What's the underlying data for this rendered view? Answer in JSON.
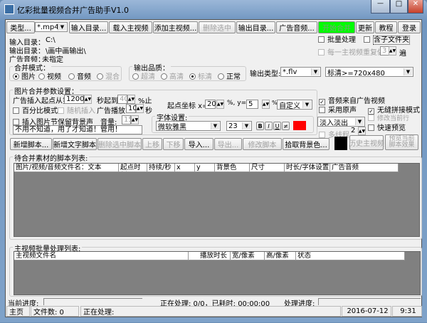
{
  "window": {
    "title": "亿彩批量视频合并广告助手V1.0"
  },
  "toolbar": {
    "type": "类型...",
    "type_value": "*.mp4",
    "input_dir": "输入目录...",
    "load_main": "载入主视频",
    "add_main": "添加主视频...",
    "delete_sel": "删除选中",
    "output_dir": "输出目录...",
    "ad_audio": "广告音频...",
    "start": "开始合并",
    "update": "更新",
    "tutorial": "教程",
    "login": "登录",
    "start_color": "#00ff00"
  },
  "info": {
    "input_label": "输入目录：",
    "input_value": "C:\\",
    "output_label": "输出目录：",
    "output_value": "\\画中画输出\\",
    "audio_label": "广告音频：",
    "audio_value": "未指定"
  },
  "batch": {
    "batch_process": "批量处理",
    "subfolders": "含子文件夹",
    "repeat": "每一主视频重复做",
    "repeat_value": "3",
    "times": "遍"
  },
  "merge_mode": {
    "label": "合并模式：",
    "options": [
      "图片",
      "视频",
      "音频",
      "混合"
    ],
    "selected": "图片"
  },
  "quality": {
    "label": "输出品质：",
    "options": [
      "超清",
      "高清",
      "标清",
      "正常"
    ],
    "selected": "标清"
  },
  "output_type": {
    "label": "输出类型:",
    "value": "*.flv",
    "resolution": "标清>=720x480"
  },
  "image_params": {
    "label": "图片合并参数设置：",
    "start_from": "广告插入起点从第",
    "start_value": "1200",
    "sec_to": "秒起到",
    "to_value": "40",
    "pct_end": "%止",
    "percent_mode": "百分比模式",
    "random_insert": "随机插入",
    "ad_play": "广告播放:",
    "play_value": "10",
    "sec": "秒",
    "keep_bg": "插入图片节保留背景声",
    "volume": "音量:",
    "volume_value": "15",
    "text": "不用不知道，用了才知道！管用！",
    "coord_label": "起点坐标 x=",
    "x_value": "20",
    "y_label": "%, y=",
    "y_value": "5",
    "pct": "%",
    "position": "自定义"
  },
  "font": {
    "label": "字体设置:",
    "family": "微软雅黑",
    "size": "23",
    "bold": "B",
    "italic": "I",
    "underline": "U",
    "strike": "≠",
    "color": "#ff0000"
  },
  "options": {
    "audio_from_ad": "音频来自广告视频",
    "use_original": "采用原声",
    "seamless": "无缝拼接模式",
    "transition": "淡入淡出",
    "modify_row": "修改当前行",
    "quick_preview": "快速预览",
    "multithread": "多线程",
    "threads": "2"
  },
  "script_buttons": {
    "new_script": "新增脚本...",
    "new_text": "新增文字脚本",
    "delete_script": "删除选中脚本",
    "up": "上移",
    "down": "下移",
    "import": "导入...",
    "export": "导出...",
    "modify": "修改脚本",
    "pick_bg": "拾取背景色...",
    "bg_color": "#000000",
    "history": "历史主视频",
    "preview": "预览当前脚本效果"
  },
  "script_list": {
    "label": "待合并素材的脚本列表:",
    "columns": [
      "图片/视频/音频文件名：文本",
      "起点时刻",
      "持续/秒",
      "x",
      "y",
      "背景色",
      "尺寸",
      "时长/字体设置",
      "广告音频"
    ]
  },
  "batch_list": {
    "label": "主视频批量处理列表:",
    "columns": [
      "主视频文件名",
      "播放时长",
      "宽/像素",
      "高/像素",
      "状态"
    ]
  },
  "progress": {
    "current": "当前进度:",
    "processing": "正在处理: 0/0，已耗时: 00:00:00",
    "process_progress": "处理进度:"
  },
  "status": {
    "home": "主页",
    "files": "文件数: 0",
    "processing": "正在处理:",
    "date": "2016-07-12",
    "time": "9:31"
  }
}
